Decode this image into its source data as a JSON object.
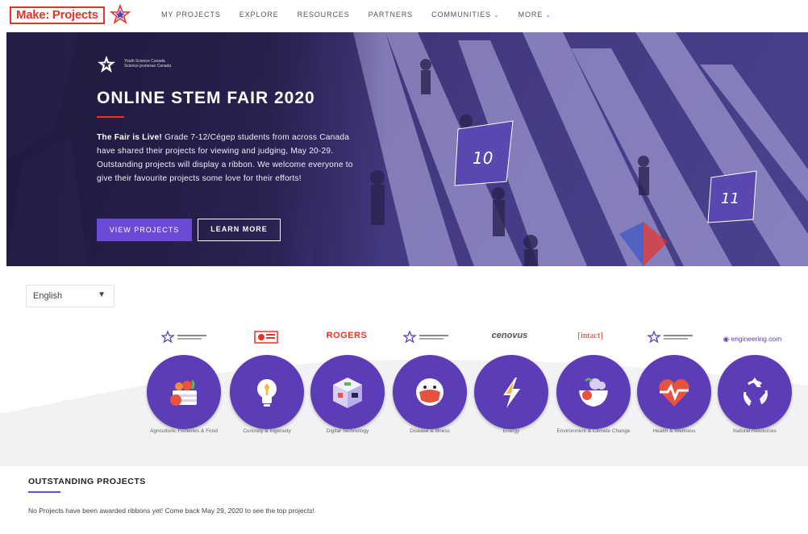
{
  "nav": {
    "logo_text": "Make: Projects",
    "items": [
      {
        "label": "MY PROJECTS",
        "has_dropdown": false
      },
      {
        "label": "EXPLORE",
        "has_dropdown": false
      },
      {
        "label": "RESOURCES",
        "has_dropdown": false
      },
      {
        "label": "PARTNERS",
        "has_dropdown": false
      },
      {
        "label": "COMMUNITIES",
        "has_dropdown": true
      },
      {
        "label": "MORE",
        "has_dropdown": true
      }
    ]
  },
  "hero": {
    "org_name_line1": "Youth Science Canada",
    "org_name_line2": "Science jeunesse Canada",
    "title": "ONLINE STEM FAIR 2020",
    "body_bold": "The Fair is Live!",
    "body": " Grade 7-12/Cégep students from across Canada have shared their projects for viewing and judging, May 20-29. Outstanding projects will display a ribbon. We welcome everyone to give their favourite projects some love for their efforts!",
    "primary_button": "VIEW PROJECTS",
    "secondary_button": "LEARN MORE",
    "booth_numbers": [
      "10",
      "11"
    ]
  },
  "language": {
    "selected": "English"
  },
  "categories": [
    {
      "label": "Agriculture, Fisheries & Food",
      "sponsor": "youth-science-canada",
      "icon": "food-basket-icon"
    },
    {
      "label": "Curiosity & Ingenuity",
      "sponsor": "sponsor-red-logo",
      "icon": "lightbulb-icon"
    },
    {
      "label": "Digital Technology",
      "sponsor": "ROGERS",
      "icon": "cube-chip-icon"
    },
    {
      "label": "Disease & Illness",
      "sponsor": "youth-science-canada",
      "icon": "mask-face-icon"
    },
    {
      "label": "Energy",
      "sponsor": "cenovus",
      "icon": "lightning-icon"
    },
    {
      "label": "Environment & Climate Change",
      "sponsor": "[intact]",
      "icon": "environment-icon"
    },
    {
      "label": "Health & Wellness",
      "sponsor": "youth-science-canada",
      "icon": "heart-pulse-icon"
    },
    {
      "label": "Natural Resources",
      "sponsor": "engineering.com",
      "icon": "recycle-icon"
    }
  ],
  "outstanding": {
    "title": "OUTSTANDING PROJECTS",
    "message": "No Projects have been awarded ribbons yet! Come back May 29, 2020 to see the top projects!"
  },
  "colors": {
    "brand_red": "#e63329",
    "accent_purple": "#6b4bd6",
    "circle_purple": "#5d3cb8"
  }
}
